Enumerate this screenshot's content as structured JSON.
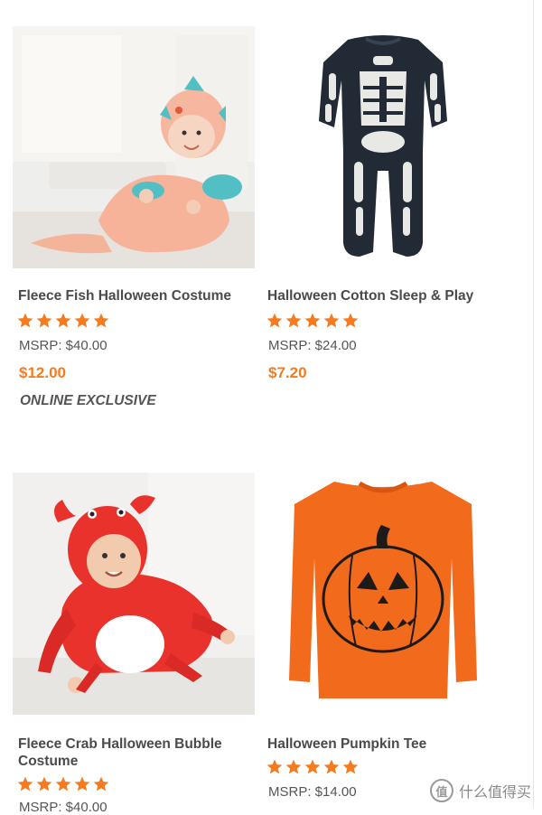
{
  "products": [
    {
      "name": "Fleece Fish Halloween Costume",
      "rating_stars": 5,
      "msrp": "MSRP: $40.00",
      "price": "$12.00",
      "badge": "ONLINE EXCLUSIVE",
      "image": "baby-fish-costume"
    },
    {
      "name": "Halloween Cotton Sleep & Play",
      "rating_stars": 5,
      "msrp": "MSRP: $24.00",
      "price": "$7.20",
      "badge": "",
      "image": "skeleton-sleep-and-play"
    },
    {
      "name": "Fleece Crab Halloween Bubble Costume",
      "rating_stars": 5,
      "msrp": "MSRP: $40.00",
      "price": "",
      "badge": "",
      "image": "baby-crab-costume"
    },
    {
      "name": "Halloween Pumpkin Tee",
      "rating_stars": 5,
      "msrp": "MSRP: $14.00",
      "price": "",
      "badge": "",
      "image": "pumpkin-tee"
    }
  ],
  "watermark": {
    "text": "什么值得买",
    "icon_glyph": "值"
  },
  "colors": {
    "price": "#f47b20",
    "star": "#f47b20",
    "name": "#4a4a4a",
    "text": "#555555"
  }
}
